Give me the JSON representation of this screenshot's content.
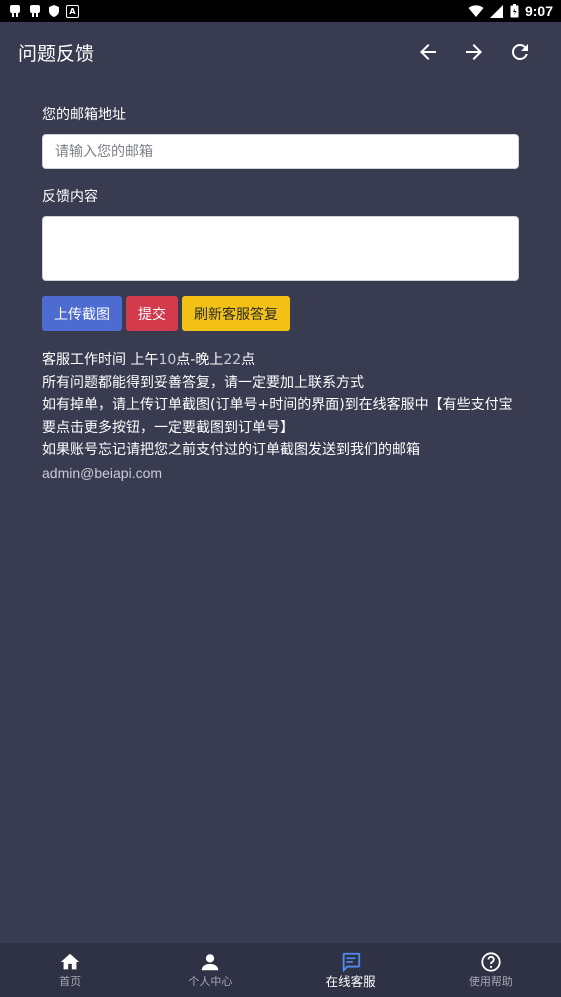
{
  "status_bar": {
    "left_icons": [
      "app-icon-1",
      "app-icon-2",
      "shield-icon",
      "a-icon"
    ],
    "time": "9:07"
  },
  "app_bar": {
    "title": "问题反馈",
    "icons": [
      "back-arrow-icon",
      "forward-arrow-icon",
      "refresh-icon"
    ]
  },
  "form": {
    "email_label": "您的邮箱地址",
    "email_placeholder": "请输入您的邮箱",
    "email_value": "",
    "feedback_label": "反馈内容",
    "feedback_value": ""
  },
  "buttons": {
    "upload": "上传截图",
    "submit": "提交",
    "refresh_reply": "刷新客服答复"
  },
  "info": {
    "line1_prefix": "客服工作时间 上午",
    "line1_am": "10",
    "line1_mid": "点-晚上",
    "line1_pm": "22",
    "line1_suffix": "点",
    "line2": "所有问题都能得到妥善答复，请一定要加上联系方式",
    "line3": "如有掉单，请上传订单截图(订单号+时间的界面)到在线客服中【有些支付宝要点击更多按钮，一定要截图到订单号】",
    "line4": "如果账号忘记请把您之前支付过的订单截图发送到我们的邮箱",
    "email": "admin@beiapi.com"
  },
  "bottom_nav": {
    "items": [
      {
        "label": "首页",
        "icon": "home-icon",
        "active": false
      },
      {
        "label": "个人中心",
        "icon": "person-icon",
        "active": false
      },
      {
        "label": "在线客服",
        "icon": "chat-icon",
        "active": true
      },
      {
        "label": "使用帮助",
        "icon": "help-icon",
        "active": false
      }
    ]
  },
  "colors": {
    "background": "#393b50",
    "bottom_nav": "#2f3144",
    "upload_button": "#4e6bd1",
    "submit_button": "#d33a4c",
    "refresh_button": "#f3c116"
  }
}
